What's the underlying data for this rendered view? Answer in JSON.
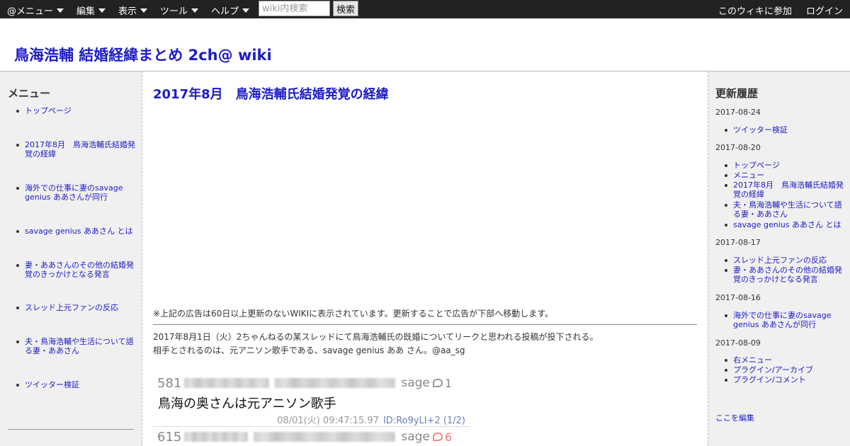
{
  "topbar": {
    "menus": [
      "@メニュー",
      "編集",
      "表示",
      "ツール",
      "ヘルプ"
    ],
    "search_placeholder": "wiki内検索",
    "search_button": "検索",
    "join": "このウィキに参加",
    "login": "ログイン"
  },
  "header": {
    "title": "鳥海浩輔 結婚経緯まとめ 2ch@ wiki"
  },
  "left_sidebar": {
    "heading": "メニュー",
    "items": [
      "トップページ",
      "2017年8月　鳥海浩輔氏結婚発覚の経緯",
      "海外での仕事に妻のsavage genius ああさんが同行",
      "savage genius ああさん とは",
      "妻・ああさんのその他の結婚発覚のきっかけとなる発言",
      "スレッド上元ファンの反応",
      "夫・鳥海浩輔や生活について語る妻・ああさん",
      "ツイッター検証"
    ]
  },
  "main": {
    "heading": "2017年8月　鳥海浩輔氏結婚発覚の経緯",
    "ad_notice": "※上記の広告は60日以上更新のないWIKIに表示されています。更新することで広告が下部へ移動します。",
    "line1": "2017年8月1日（火）2ちゃんねるの某スレッドにて鳥海浩輔氏の既婚についてリークと思われる投稿が投下される。",
    "line2": "相手とされるのは、元アニソン歌手である、savage genius ああ さん。@aa_sg",
    "post_image": {
      "post1_number": "581",
      "post1_sage": "sage",
      "post1_replies": "1",
      "post1_text": "鳥海の奥さんは元アニソン歌手",
      "post1_date": "08/01(火) 09:47:15.97",
      "post1_id": "ID:Ro9yLI+2 (1/2)",
      "post2_number": "615",
      "post2_sage": "sage",
      "post2_replies": "6"
    }
  },
  "right_sidebar": {
    "heading": "更新履歴",
    "groups": [
      {
        "date": "2017-08-24",
        "items": [
          "ツイッター検証"
        ]
      },
      {
        "date": "2017-08-20",
        "items": [
          "トップページ",
          "メニュー",
          "2017年8月　鳥海浩輔氏結婚発覚の経緯",
          "夫・鳥海浩輔や生活について語る妻・ああさん",
          "savage genius ああさん とは"
        ]
      },
      {
        "date": "2017-08-17",
        "items": [
          "スレッド上元ファンの反応",
          "妻・ああさんのその他の結婚発覚のきっかけとなる発言"
        ]
      },
      {
        "date": "2017-08-16",
        "items": [
          "海外での仕事に妻のsavage genius ああさんが同行"
        ]
      },
      {
        "date": "2017-08-09",
        "items": [
          "右メニュー",
          "プラグイン/アーカイブ",
          "プラグイン/コメント"
        ]
      }
    ],
    "edit_link": "ここを編集"
  }
}
